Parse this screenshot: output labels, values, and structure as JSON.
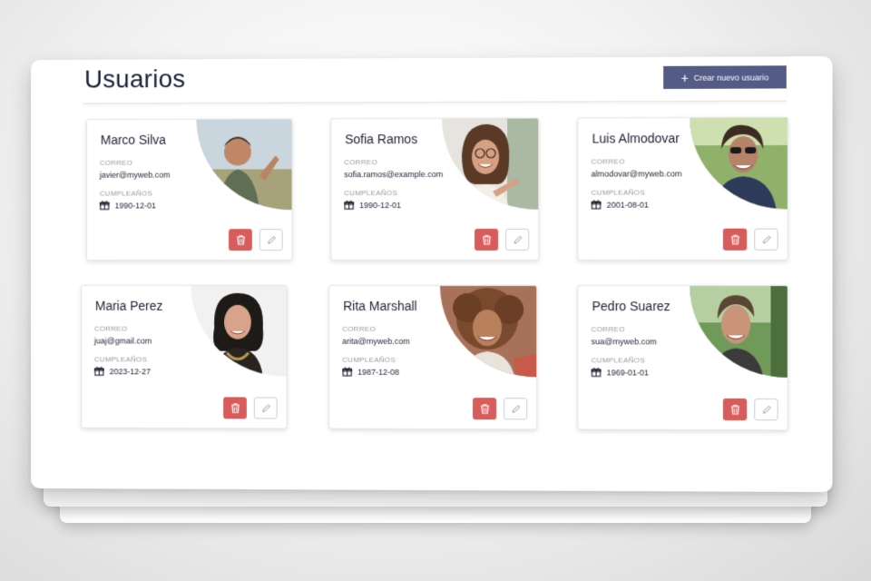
{
  "header": {
    "title": "Usuarios",
    "create_button_label": "Crear nuevo usuario"
  },
  "labels": {
    "email": "CORREO",
    "birthday": "CUMPLEAÑOS"
  },
  "users": [
    {
      "name": "Marco Silva",
      "email": "javier@myweb.com",
      "birthday": "1990-12-01"
    },
    {
      "name": "Sofia Ramos",
      "email": "sofia.ramos@example.com",
      "birthday": "1990-12-01"
    },
    {
      "name": "Luis Almodovar",
      "email": "almodovar@myweb.com",
      "birthday": "2001-08-01"
    },
    {
      "name": "Maria Perez",
      "email": "juaj@gmail.com",
      "birthday": "2023-12-27"
    },
    {
      "name": "Rita Marshall",
      "email": "arita@myweb.com",
      "birthday": "1987-12-08"
    },
    {
      "name": "Pedro Suarez",
      "email": "sua@myweb.com",
      "birthday": "1969-01-01"
    }
  ],
  "icons": {
    "create": "plus-icon",
    "birthday": "gift-icon",
    "delete": "trash-icon",
    "edit": "pencil-icon"
  },
  "colors": {
    "primary": "#535b86",
    "danger": "#d95c5c",
    "title": "#1b2036"
  }
}
